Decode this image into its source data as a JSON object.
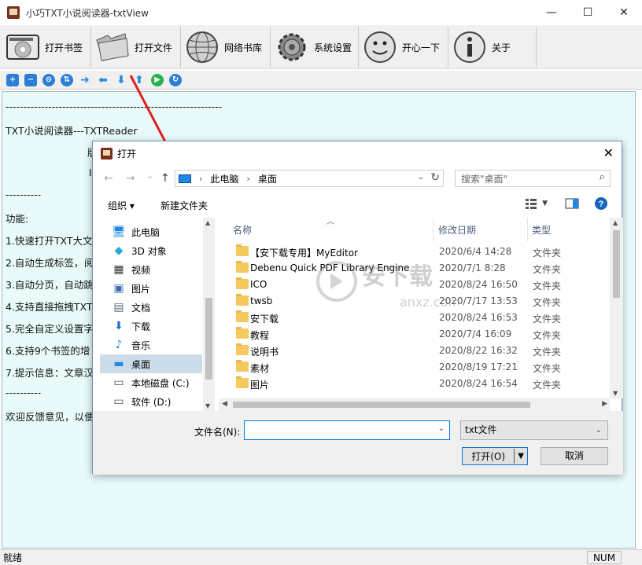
{
  "window": {
    "title": "小巧TXT小说阅读器-txtView",
    "minimize": "—",
    "maximize": "☐",
    "close": "✕"
  },
  "toolbar": [
    {
      "label": "打开书签",
      "icon": "bookmark-drive-icon"
    },
    {
      "label": "打开文件",
      "icon": "folder-icon"
    },
    {
      "label": "网络书库",
      "icon": "globe-icon"
    },
    {
      "label": "系统设置",
      "icon": "gear-icon"
    },
    {
      "label": "开心一下",
      "icon": "smiley-icon"
    },
    {
      "label": "关于",
      "icon": "info-icon"
    }
  ],
  "small_toolbar": [
    "add-icon",
    "remove-icon",
    "up-circle-icon",
    "swap-icon",
    "arrow-right-icon",
    "arrow-left-icon",
    "arrow-down-icon",
    "arrow-up-icon",
    "play-icon",
    "refresh-icon"
  ],
  "content": {
    "separator": "-------------------------------------------------------------",
    "line1": "TXT小说阅读器---TXTReader",
    "frag1": "版",
    "frag2": "I",
    "sep2": "----------",
    "features_title": "功能:",
    "f1": "1.快速打开TXT大文",
    "f2": "2.自动生成标签，",
    "f2b": "阅",
    "f3": "3.自动分页，自动跳",
    "f4": "4.支持直接拖拽TXT",
    "f5": "5.完全自定义设置字",
    "f6": "6.支持9个书签的增",
    "f7": "7.提示信息：文章汉",
    "sep3": "----------",
    "feedback": "欢迎反馈意见，以便"
  },
  "status": {
    "ready": "就绪",
    "num": "NUM"
  },
  "dialog": {
    "title": "打开",
    "close": "✕",
    "nav": {
      "back": "←",
      "forward": "→",
      "dropdown": "⌄",
      "up": "↑"
    },
    "address": {
      "crumbs": [
        "此电脑",
        "桌面"
      ],
      "sep": "›"
    },
    "search_placeholder": "搜索\"桌面\"",
    "commands": {
      "organize": "组织 ▾",
      "new_folder": "新建文件夹"
    },
    "left_nav": [
      {
        "label": "此电脑",
        "icon": "pc-icon",
        "glyph": "🖥"
      },
      {
        "label": "3D 对象",
        "icon": "cube-icon",
        "glyph": "◆"
      },
      {
        "label": "视频",
        "icon": "video-icon",
        "glyph": "▦"
      },
      {
        "label": "图片",
        "icon": "picture-icon",
        "glyph": "▣"
      },
      {
        "label": "文档",
        "icon": "document-icon",
        "glyph": "▤"
      },
      {
        "label": "下载",
        "icon": "download-icon",
        "glyph": "⬇"
      },
      {
        "label": "音乐",
        "icon": "music-icon",
        "glyph": "♪"
      },
      {
        "label": "桌面",
        "icon": "desktop-icon",
        "glyph": "▬",
        "selected": true
      },
      {
        "label": "本地磁盘 (C:)",
        "icon": "drive-c-icon",
        "glyph": "▭"
      },
      {
        "label": "软件 (D:)",
        "icon": "drive-d-icon",
        "glyph": "▭"
      }
    ],
    "columns": {
      "name": "名称",
      "date": "修改日期",
      "type": "类型"
    },
    "files": [
      {
        "name": "【安下载专用】MyEditor",
        "date": "2020/6/4 14:28",
        "type": "文件夹"
      },
      {
        "name": "Debenu Quick PDF Library Engine",
        "date": "2020/7/1 8:28",
        "type": "文件夹"
      },
      {
        "name": "ICO",
        "date": "2020/8/24 16:50",
        "type": "文件夹"
      },
      {
        "name": "twsb",
        "date": "2020/7/17 13:53",
        "type": "文件夹"
      },
      {
        "name": "安下载",
        "date": "2020/8/24 16:53",
        "type": "文件夹"
      },
      {
        "name": "教程",
        "date": "2020/7/4 16:09",
        "type": "文件夹"
      },
      {
        "name": "说明书",
        "date": "2020/8/22 16:32",
        "type": "文件夹"
      },
      {
        "name": "素材",
        "date": "2020/8/19 17:21",
        "type": "文件夹"
      },
      {
        "name": "图片",
        "date": "2020/8/24 16:54",
        "type": "文件夹"
      }
    ],
    "watermark": {
      "text": "安下载",
      "sub": "anxz.com"
    },
    "filename_label": "文件名(N):",
    "filename_value": "",
    "filetype": "txt文件",
    "open_button": "打开(O)",
    "cancel_button": "取消"
  }
}
